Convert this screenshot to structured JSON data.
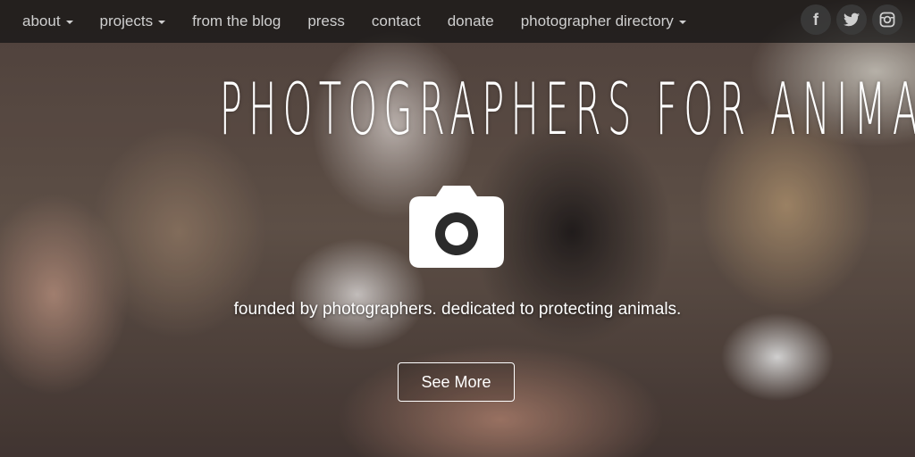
{
  "nav": {
    "items": [
      {
        "label": "about",
        "dropdown": true
      },
      {
        "label": "projects",
        "dropdown": true
      },
      {
        "label": "from the blog",
        "dropdown": false
      },
      {
        "label": "press",
        "dropdown": false
      },
      {
        "label": "contact",
        "dropdown": false
      },
      {
        "label": "donate",
        "dropdown": false
      },
      {
        "label": "photographer directory",
        "dropdown": true
      }
    ],
    "social": [
      {
        "label": "f",
        "icon": "facebook-icon"
      },
      {
        "label": "",
        "icon": "twitter-icon"
      },
      {
        "label": "",
        "icon": "instagram-icon"
      }
    ]
  },
  "hero": {
    "title": "PHOTOGRAPHERS FOR ANIMALS",
    "icon": "camera-icon",
    "tagline": "founded by photographers. dedicated to protecting animals.",
    "button_label": "See More"
  },
  "colors": {
    "nav_bg": "#141414",
    "nav_text": "#cfcfcf",
    "hero_text": "#ffffff"
  }
}
